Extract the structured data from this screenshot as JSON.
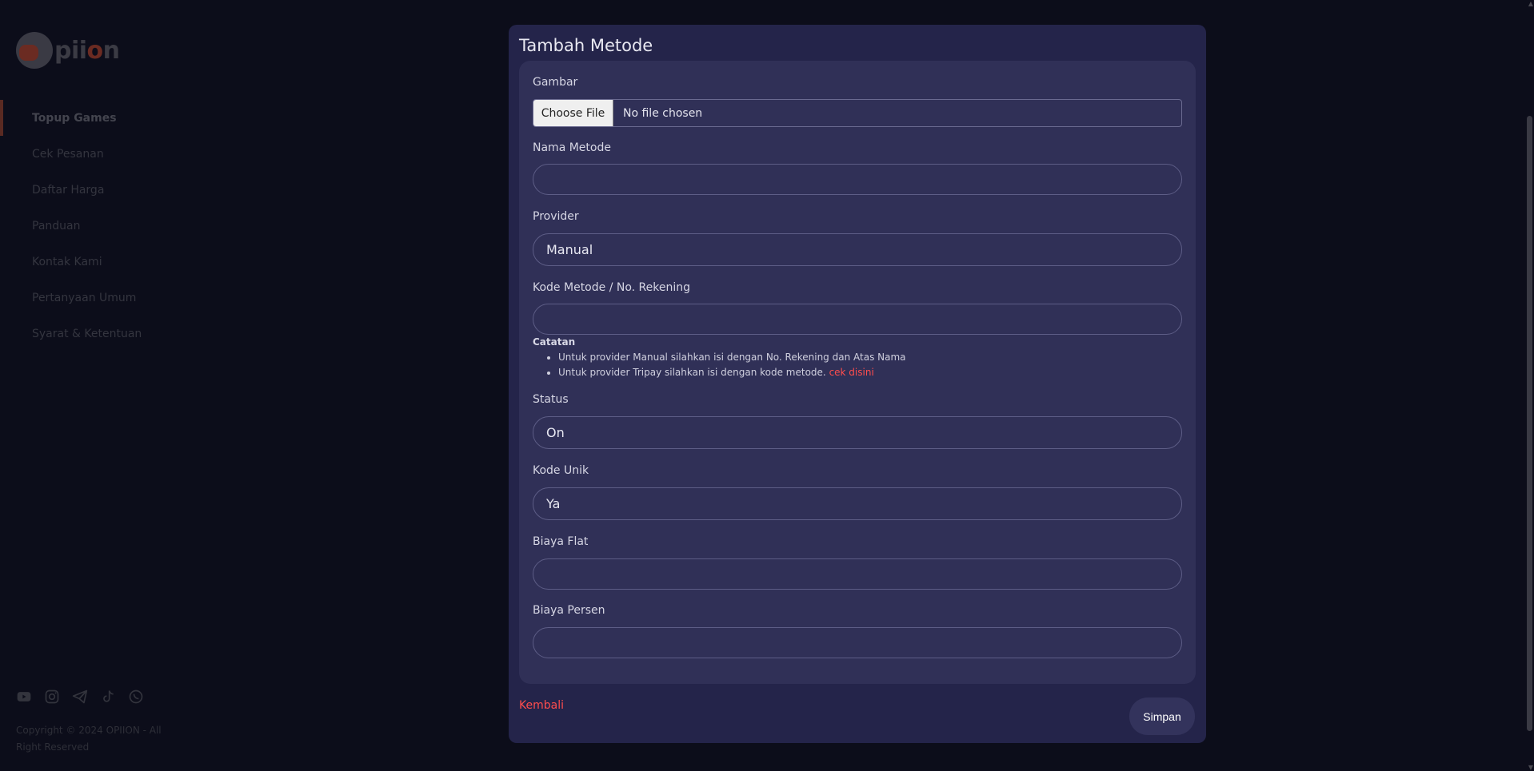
{
  "sidebar": {
    "logo_text": "piion",
    "nav": [
      {
        "label": "Topup Games"
      },
      {
        "label": "Cek Pesanan"
      },
      {
        "label": "Daftar Harga"
      },
      {
        "label": "Panduan"
      },
      {
        "label": "Kontak Kami"
      },
      {
        "label": "Pertanyaan Umum"
      },
      {
        "label": "Syarat & Ketentuan"
      }
    ],
    "socials": [
      "youtube-icon",
      "instagram-icon",
      "telegram-icon",
      "tiktok-icon",
      "whatsapp-icon"
    ],
    "copyright": "Copyright © 2024 OPIION - All Right Reserved"
  },
  "modal": {
    "title": "Tambah Metode",
    "fields": {
      "gambar_label": "Gambar",
      "file_button": "Choose File",
      "file_status": "No file chosen",
      "nama_label": "Nama Metode",
      "nama_value": "",
      "provider_label": "Provider",
      "provider_value": "Manual",
      "kode_label": "Kode Metode / No. Rekening",
      "kode_value": "",
      "status_label": "Status",
      "status_value": "On",
      "kode_unik_label": "Kode Unik",
      "kode_unik_value": "Ya",
      "biaya_flat_label": "Biaya Flat",
      "biaya_flat_value": "",
      "biaya_persen_label": "Biaya Persen",
      "biaya_persen_value": ""
    },
    "note": {
      "title": "Catatan",
      "item1": "Untuk provider Manual silahkan isi dengan No. Rekening dan Atas Nama",
      "item2": "Untuk provider Tripay silahkan isi dengan kode metode.",
      "item2_link": "cek disini"
    },
    "back_label": "Kembali",
    "save_label": "Simpan"
  },
  "colors": {
    "background": "#0c0d1a",
    "modal": "#24244a",
    "card": "#303057",
    "accent_red": "#ff4d4d"
  }
}
